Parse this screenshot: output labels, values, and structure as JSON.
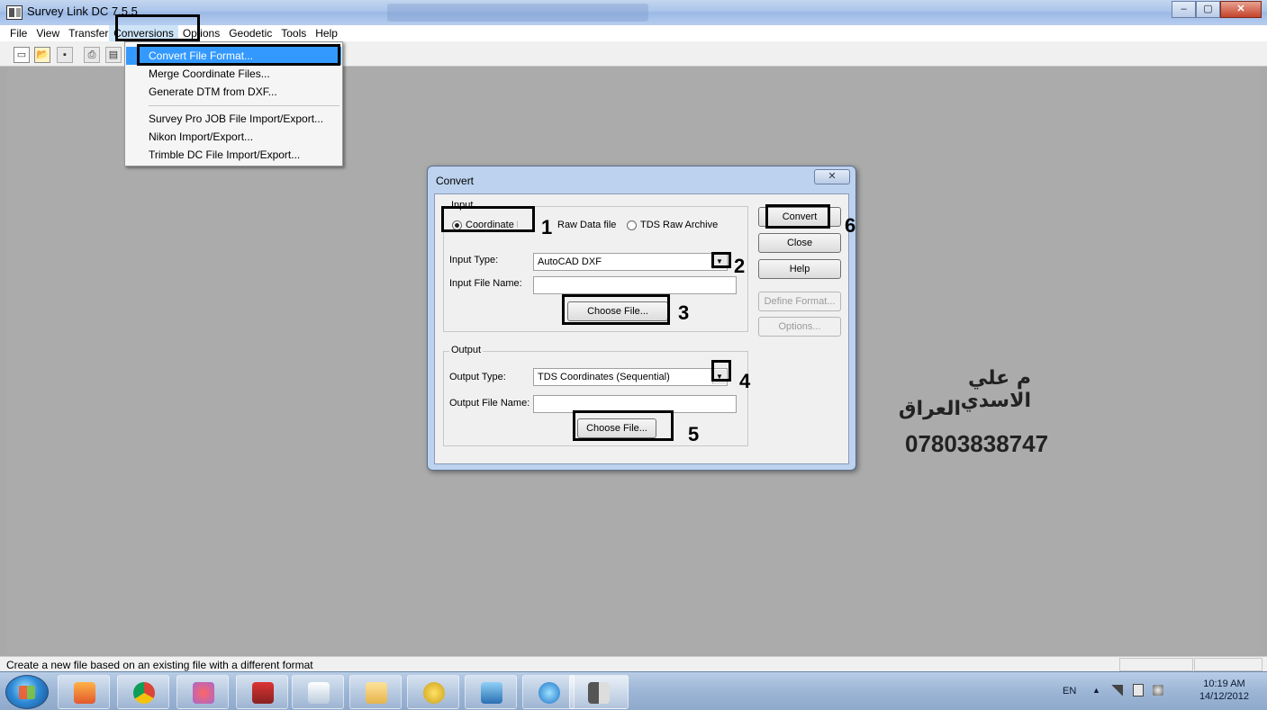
{
  "window": {
    "title": "Survey Link DC 7.5.5",
    "controls": {
      "minimize": "–",
      "maximize": "▢",
      "close": "✕"
    }
  },
  "menubar": {
    "items": [
      "File",
      "View",
      "Transfer",
      "Conversions",
      "Options",
      "Geodetic",
      "Tools",
      "Help"
    ],
    "active": "Conversions"
  },
  "toolbar": {
    "icons": [
      "new-file-icon",
      "open-folder-icon",
      "save-icon",
      "print-icon",
      "print-preview-icon"
    ]
  },
  "conversions_menu": {
    "items": [
      {
        "label": "Convert File Format...",
        "highlighted": true
      },
      {
        "label": "Merge Coordinate Files..."
      },
      {
        "label": "Generate DTM from DXF..."
      },
      {
        "label": "Survey Pro JOB File Import/Export..."
      },
      {
        "label": "Nikon Import/Export..."
      },
      {
        "label": "Trimble DC File Import/Export..."
      }
    ]
  },
  "dialog": {
    "title": "Convert",
    "close_glyph": "✕",
    "input_group": {
      "label": "Input",
      "radios": [
        {
          "label": "Coordinate File",
          "checked": true
        },
        {
          "label": "Raw Data file",
          "checked": false
        },
        {
          "label": "TDS Raw Archive",
          "checked": false
        }
      ],
      "input_type_label": "Input Type:",
      "input_type_value": "AutoCAD DXF",
      "input_file_label": "Input File Name:",
      "input_file_value": "",
      "choose_file": "Choose File..."
    },
    "output_group": {
      "label": "Output",
      "output_type_label": "Output Type:",
      "output_type_value": "TDS Coordinates (Sequential)",
      "output_file_label": "Output File Name:",
      "output_file_value": "",
      "choose_file": "Choose File..."
    },
    "buttons": {
      "convert": "Convert",
      "close": "Close",
      "help": "Help",
      "define_format": "Define Format...",
      "options": "Options..."
    }
  },
  "annotations": [
    "1",
    "2",
    "3",
    "4",
    "5",
    "6"
  ],
  "watermark": {
    "line1": "م علي الاسدي",
    "line2": "العراق",
    "line3": "07803838747"
  },
  "statusbar": {
    "text": "Create a new file based on an existing file with a different format"
  },
  "taskbar": {
    "apps": [
      "media-player-icon",
      "chrome-icon",
      "paint-splash-icon",
      "autocad-icon",
      "paint-icon",
      "explorer-icon",
      "media-center-icon",
      "screen-icon",
      "internet-explorer-icon",
      "survey-link-icon"
    ],
    "tray_lang": "EN",
    "tray_arrow": "▲",
    "time": "10:19 AM",
    "date": "14/12/2012"
  }
}
